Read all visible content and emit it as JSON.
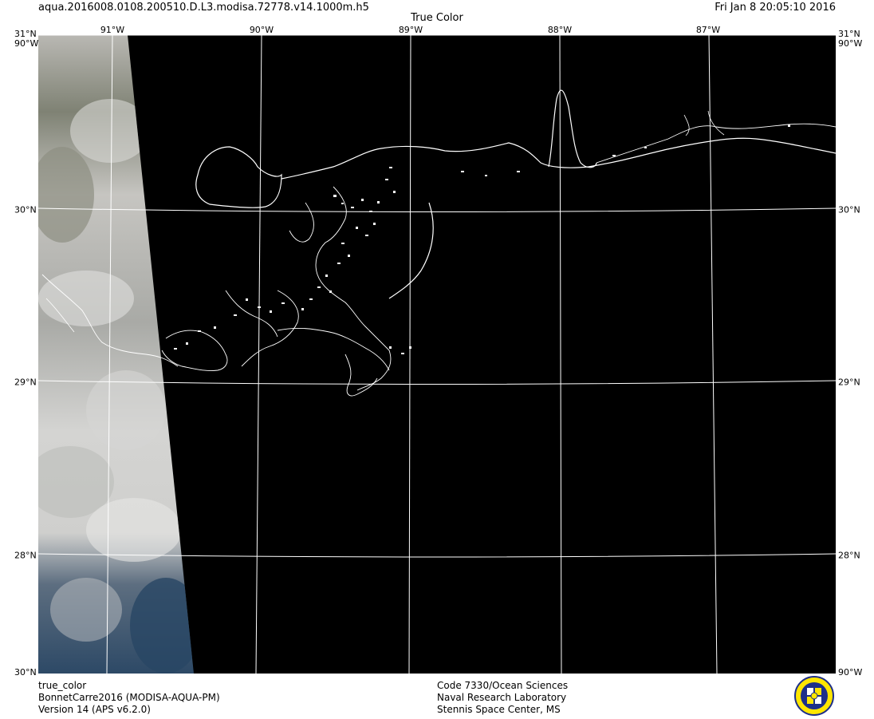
{
  "header": {
    "filename": "aqua.2016008.0108.200510.D.L3.modisa.72778.v14.1000m.h5",
    "datetime": "Fri Jan  8 20:05:10 2016",
    "product_title": "True Color"
  },
  "map": {
    "lon_labels": [
      "91°W",
      "90°W",
      "89°W",
      "88°W",
      "87°W"
    ],
    "lat_labels": [
      "30°N",
      "29°N",
      "28°N"
    ],
    "corner_top_left": "31°N",
    "corner_top_right": "31°N",
    "corner_side_top": "90°W",
    "corner_bottom_left": "30°N",
    "corner_bottom_right": "90°W",
    "colors": {
      "ocean": "#000000",
      "grid": "#ffffff",
      "coastline": "#ffffff",
      "cloud": "#c9c9c6",
      "water_visible": "#2e4a66"
    }
  },
  "footer": {
    "line1": "true_color",
    "line2": "BonnetCarre2016 (MODISA-AQUA-PM)",
    "line3": "Version 14 (APS v6.2.0)",
    "org1": "Code 7330/Ocean Sciences",
    "org2": "Naval Research Laboratory",
    "org3": "Stennis Space Center, MS"
  }
}
